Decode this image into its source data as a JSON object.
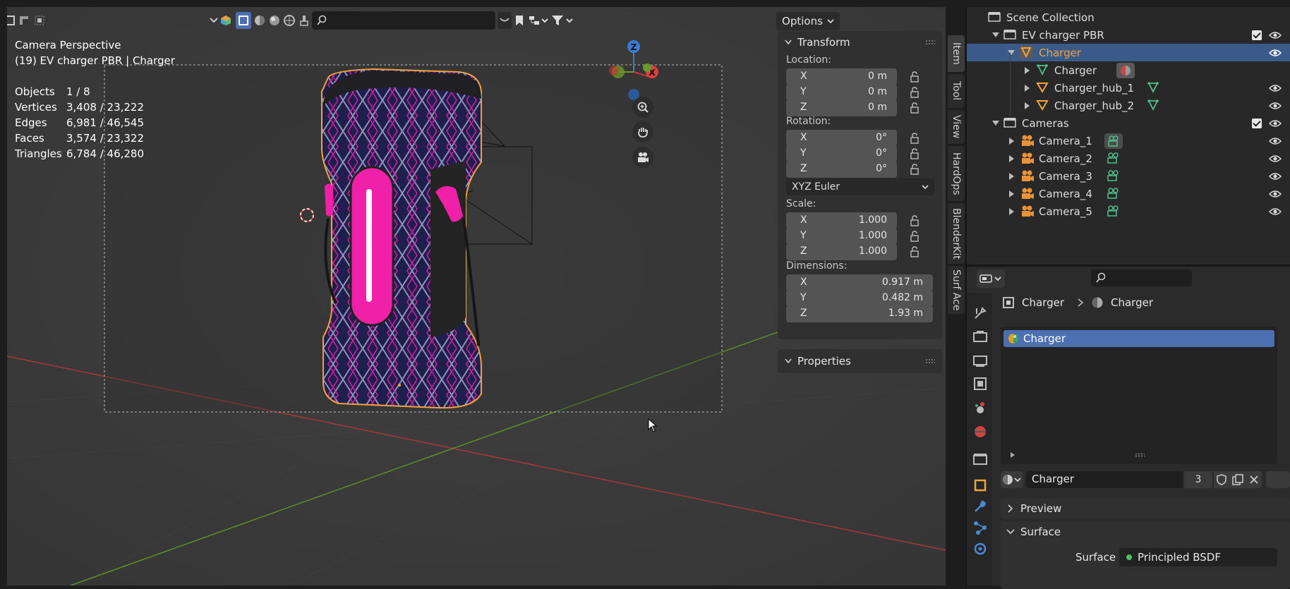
{
  "viewport": {
    "perspective_label": "Camera Perspective",
    "object_info": "(19) EV charger PBR | Charger",
    "options_label": "Options",
    "stats": [
      {
        "label": "Objects",
        "value": "1 / 8"
      },
      {
        "label": "Vertices",
        "value": "3,408 / 23,222"
      },
      {
        "label": "Edges",
        "value": "6,981 / 46,545"
      },
      {
        "label": "Faces",
        "value": "3,574 / 23,322"
      },
      {
        "label": "Triangles",
        "value": "6,784 / 46,280"
      }
    ],
    "gizmo": {
      "z": "Z",
      "x": "X"
    }
  },
  "npanel": {
    "transform_title": "Transform",
    "location_label": "Location:",
    "location": [
      {
        "axis": "X",
        "value": "0 m"
      },
      {
        "axis": "Y",
        "value": "0 m"
      },
      {
        "axis": "Z",
        "value": "0 m"
      }
    ],
    "rotation_label": "Rotation:",
    "rotation": [
      {
        "axis": "X",
        "value": "0°"
      },
      {
        "axis": "Y",
        "value": "0°"
      },
      {
        "axis": "Z",
        "value": "0°"
      }
    ],
    "rotation_mode": "XYZ Euler",
    "scale_label": "Scale:",
    "scale": [
      {
        "axis": "X",
        "value": "1.000"
      },
      {
        "axis": "Y",
        "value": "1.000"
      },
      {
        "axis": "Z",
        "value": "1.000"
      }
    ],
    "dimensions_label": "Dimensions:",
    "dimensions": [
      {
        "axis": "X",
        "value": "0.917 m"
      },
      {
        "axis": "Y",
        "value": "0.482 m"
      },
      {
        "axis": "Z",
        "value": "1.93 m"
      }
    ],
    "properties_title": "Properties"
  },
  "vertical_tabs": [
    "Item",
    "Tool",
    "View",
    "HardOps",
    "BlenderKit",
    "Surf Ace"
  ],
  "outliner": {
    "rows": [
      {
        "label": "Scene Collection"
      },
      {
        "label": "EV charger PBR"
      },
      {
        "label": "Charger"
      },
      {
        "label": "Charger"
      },
      {
        "label": "Charger_hub_1"
      },
      {
        "label": "Charger_hub_2"
      },
      {
        "label": "Cameras"
      },
      {
        "label": "Camera_1"
      },
      {
        "label": "Camera_2"
      },
      {
        "label": "Camera_3"
      },
      {
        "label": "Camera_4"
      },
      {
        "label": "Camera_5"
      }
    ]
  },
  "properties": {
    "breadcrumb_object": "Charger",
    "breadcrumb_material": "Charger",
    "material_slot": "Charger",
    "material_name": "Charger",
    "user_count": "3",
    "preview_label": "Preview",
    "surface_section": "Surface",
    "surface_label": "Surface",
    "surface_value": "Principled BSDF"
  },
  "colors": {
    "accent_blue": "#4b6fb0",
    "selected_orange": "#f2a33a",
    "charger_pink": "#f020a8",
    "charger_navy": "#1c1c4a"
  }
}
